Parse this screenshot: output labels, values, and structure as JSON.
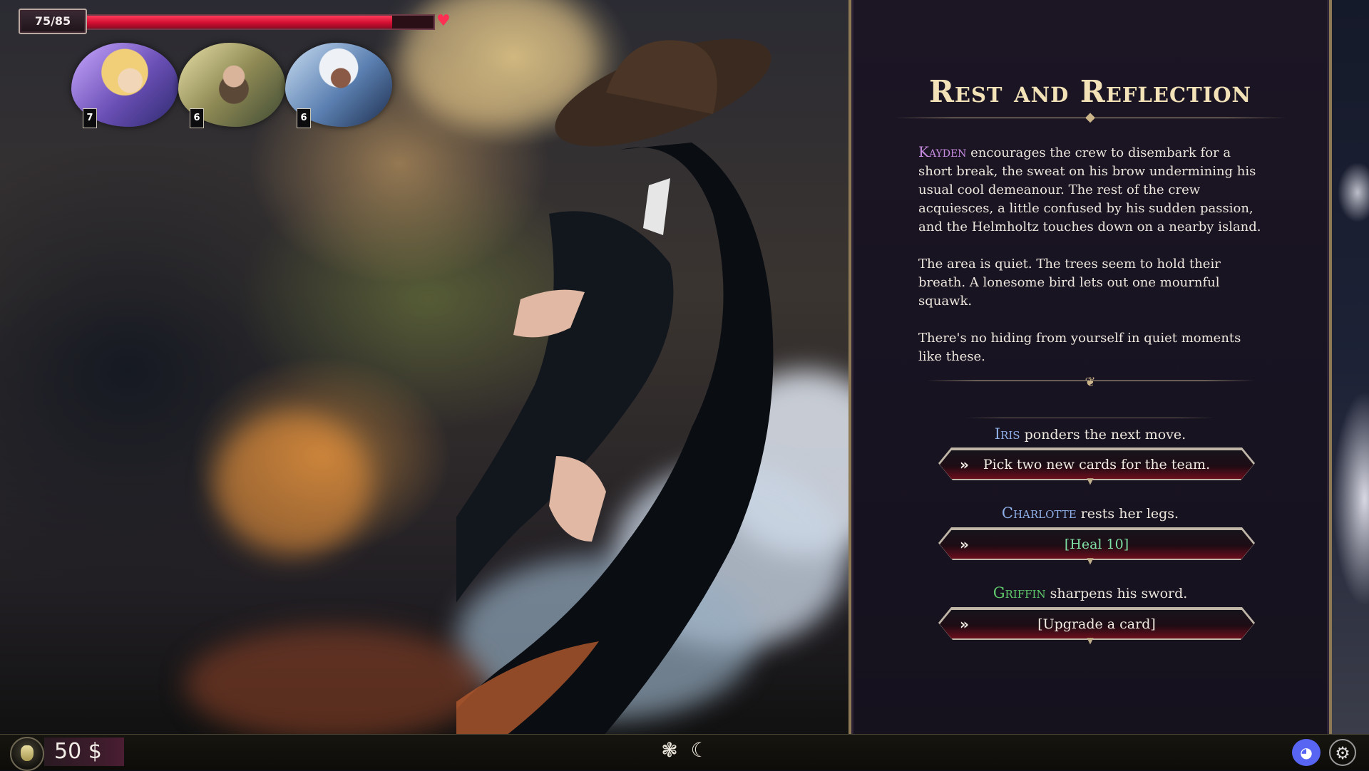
{
  "hud": {
    "hp_text": "75/85",
    "hp_current": 75,
    "hp_max": 85,
    "hp_color": "#d20f33",
    "heart_icon": "heart-icon"
  },
  "party": [
    {
      "name_hint": "charlotte",
      "cards": "7",
      "palette": "#6a4fb5"
    },
    {
      "name_hint": "griffin",
      "cards": "6",
      "palette": "#8f8a55"
    },
    {
      "name_hint": "iris",
      "cards": "6",
      "palette": "#5a7fb0"
    }
  ],
  "panel": {
    "title": "Rest and Reflection",
    "story": {
      "p1_name": "Kayden",
      "p1_rest": " encourages the crew to disembark for a short break, the sweat on his brow undermining his usual cool demeanour. The rest of the crew acquiesces, a little confused by his sudden passion, and the Helmholtz touches down on a nearby island.",
      "p2": "The area is quiet. The trees seem to hold their breath. A lonesome bird lets out one mournful squawk.",
      "p3": "There's no hiding from yourself in quiet moments like these."
    },
    "choices": [
      {
        "who": "Iris",
        "who_color": "#8fb0e8",
        "prompt_rest": " ponders the next move.",
        "button": "Pick two new cards for the team."
      },
      {
        "who": "Charlotte",
        "who_color": "#8fb0e8",
        "prompt_rest": " rests her legs.",
        "button": "[Heal 10]"
      },
      {
        "who": "Griffin",
        "who_color": "#5fc96b",
        "prompt_rest": " sharpens his sword.",
        "button": "[Upgrade a card]"
      }
    ],
    "arrow_glyph": "»"
  },
  "bottom": {
    "gold": "50 $",
    "icons": [
      "skill-tree-icon",
      "dragon-icon",
      "discord-icon",
      "settings-icon"
    ]
  }
}
